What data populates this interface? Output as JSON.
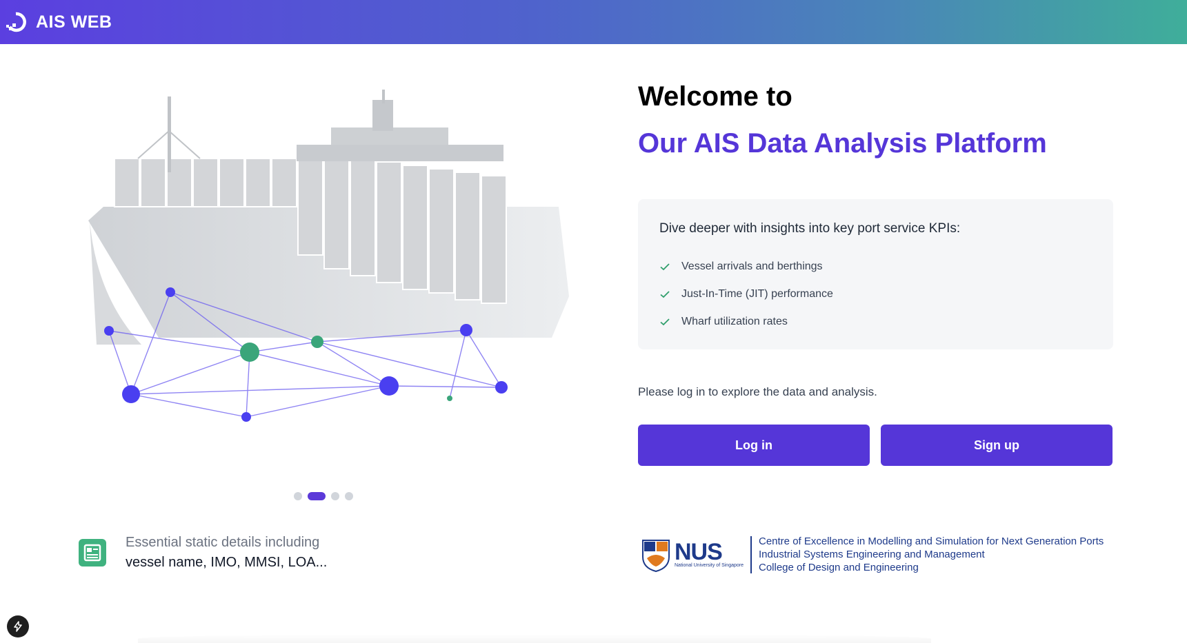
{
  "header": {
    "title": "AIS WEB",
    "logo_icon": "digitalocean-style-logo-icon",
    "gradient": [
      "#5b3fe0",
      "#3fae9a"
    ]
  },
  "hero": {
    "illustration": "container-ship-network-illustration",
    "carousel": {
      "count": 4,
      "active_index": 1
    },
    "feature": {
      "icon": "document-list-icon",
      "line1": "Essential static details including",
      "line2": "vessel name, IMO, MMSI, LOA..."
    }
  },
  "welcome": {
    "line1": "Welcome to",
    "line2": "Our AIS Data Analysis Platform"
  },
  "kpis": {
    "intro": "Dive deeper with insights into key port service KPIs:",
    "items": [
      "Vessel arrivals and berthings",
      "Just-In-Time (JIT) performance",
      "Wharf utilization rates"
    ]
  },
  "auth": {
    "prompt": "Please log in to explore the data and analysis.",
    "login_label": "Log in",
    "signup_label": "Sign up",
    "accent": "#5536d8"
  },
  "nus": {
    "short": "NUS",
    "full": "National University of Singapore",
    "lines": [
      "Centre of Excellence in Modelling and Simulation for Next Generation Ports",
      "Industrial Systems Engineering and Management",
      "College of Design and Engineering"
    ]
  }
}
